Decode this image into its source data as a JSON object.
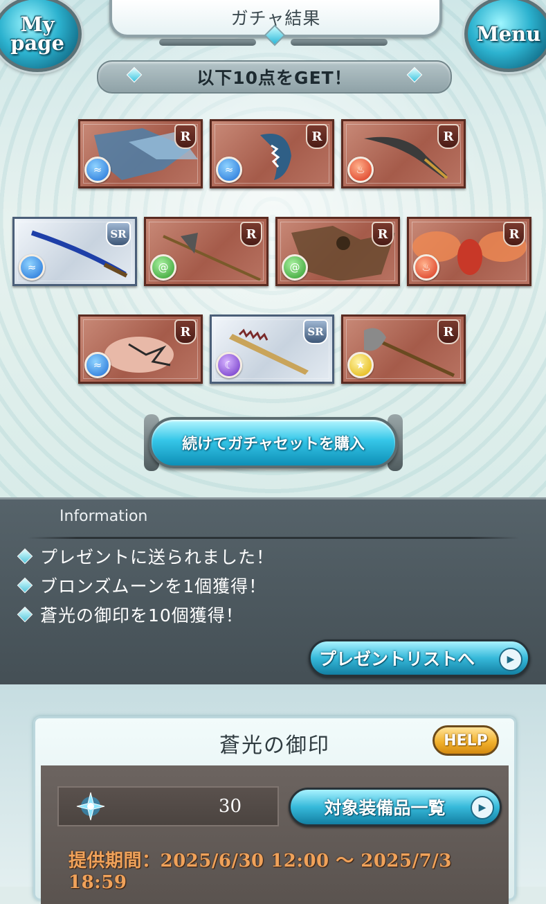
{
  "header": {
    "title": "ガチャ結果",
    "mypage_label": "My\npage",
    "menu_label": "Menu"
  },
  "result": {
    "banner": "以下10点をGET！",
    "items": [
      {
        "rarity": "R",
        "element": "water",
        "element_icon": "water-drop-icon",
        "subject": "winged-dragon-summon"
      },
      {
        "rarity": "R",
        "element": "water",
        "element_icon": "water-drop-icon",
        "subject": "fanged-blade-weapon"
      },
      {
        "rarity": "R",
        "element": "fire",
        "element_icon": "flame-icon",
        "subject": "scimitar-weapon"
      },
      {
        "rarity": "SR",
        "element": "water",
        "element_icon": "water-drop-icon",
        "subject": "blue-katana-weapon"
      },
      {
        "rarity": "R",
        "element": "wind",
        "element_icon": "wind-swirl-icon",
        "subject": "halberd-weapon"
      },
      {
        "rarity": "R",
        "element": "wind",
        "element_icon": "wind-swirl-icon",
        "subject": "griffin-summon"
      },
      {
        "rarity": "R",
        "element": "fire",
        "element_icon": "flame-icon",
        "subject": "insect-summon"
      },
      {
        "rarity": "R",
        "element": "water",
        "element_icon": "water-drop-icon",
        "subject": "tattooed-fist-weapon"
      },
      {
        "rarity": "SR",
        "element": "dark",
        "element_icon": "dark-moon-icon",
        "subject": "serrated-sword-weapon"
      },
      {
        "rarity": "R",
        "element": "light",
        "element_icon": "light-star-icon",
        "subject": "axe-weapon"
      }
    ],
    "buy_again_label": "続けてガチャセットを購入"
  },
  "information": {
    "heading": "Information",
    "lines": [
      "プレゼントに送られました！",
      "ブロンズムーンを1個獲得！",
      "蒼光の御印を10個獲得！"
    ],
    "present_button_label": "プレゼントリストへ"
  },
  "seal": {
    "title": "蒼光の御印",
    "help_label": "HELP",
    "count": "30",
    "target_button_label": "対象装備品一覧",
    "period": "提供期間：2025/6/30 12:00 〜 2025/7/3 18:59"
  },
  "colors": {
    "accent_cyan": "#35c6e8",
    "r_card": "#a55b4a",
    "sr_card": "#c8d3df",
    "period_text": "#f0a25a"
  }
}
